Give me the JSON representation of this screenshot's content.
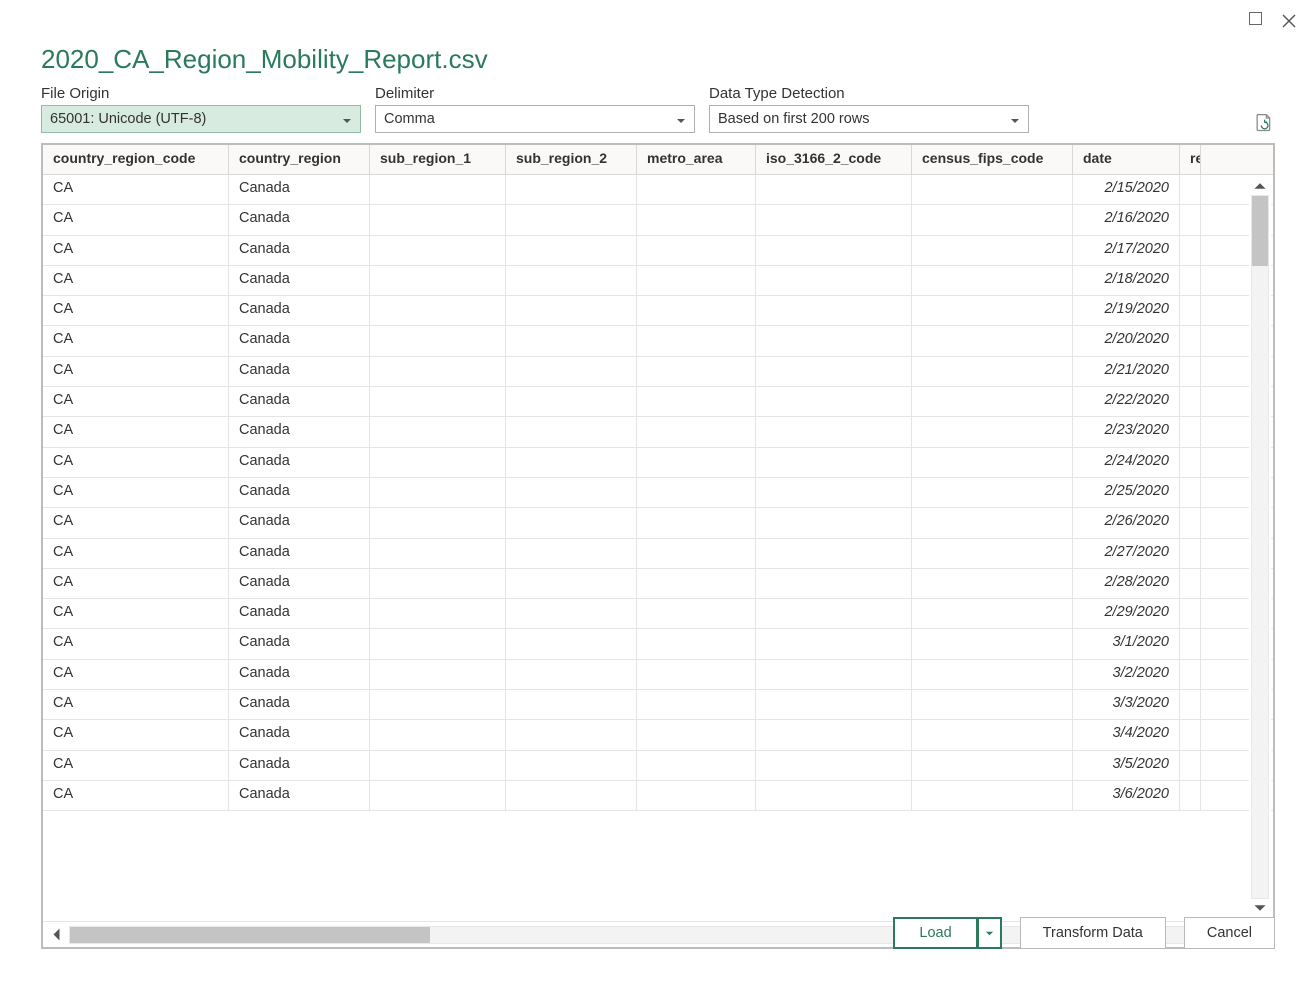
{
  "title": "2020_CA_Region_Mobility_Report.csv",
  "options": {
    "file_origin": {
      "label": "File Origin",
      "value": "65001: Unicode (UTF-8)"
    },
    "delimiter": {
      "label": "Delimiter",
      "value": "Comma"
    },
    "detection": {
      "label": "Data Type Detection",
      "value": "Based on first 200 rows"
    }
  },
  "columns": [
    "country_region_code",
    "country_region",
    "sub_region_1",
    "sub_region_2",
    "metro_area",
    "iso_3166_2_code",
    "census_fips_code",
    "date",
    "re"
  ],
  "rows": [
    {
      "code": "CA",
      "region": "Canada",
      "date": "2/15/2020"
    },
    {
      "code": "CA",
      "region": "Canada",
      "date": "2/16/2020"
    },
    {
      "code": "CA",
      "region": "Canada",
      "date": "2/17/2020"
    },
    {
      "code": "CA",
      "region": "Canada",
      "date": "2/18/2020"
    },
    {
      "code": "CA",
      "region": "Canada",
      "date": "2/19/2020"
    },
    {
      "code": "CA",
      "region": "Canada",
      "date": "2/20/2020"
    },
    {
      "code": "CA",
      "region": "Canada",
      "date": "2/21/2020"
    },
    {
      "code": "CA",
      "region": "Canada",
      "date": "2/22/2020"
    },
    {
      "code": "CA",
      "region": "Canada",
      "date": "2/23/2020"
    },
    {
      "code": "CA",
      "region": "Canada",
      "date": "2/24/2020"
    },
    {
      "code": "CA",
      "region": "Canada",
      "date": "2/25/2020"
    },
    {
      "code": "CA",
      "region": "Canada",
      "date": "2/26/2020"
    },
    {
      "code": "CA",
      "region": "Canada",
      "date": "2/27/2020"
    },
    {
      "code": "CA",
      "region": "Canada",
      "date": "2/28/2020"
    },
    {
      "code": "CA",
      "region": "Canada",
      "date": "2/29/2020"
    },
    {
      "code": "CA",
      "region": "Canada",
      "date": "3/1/2020"
    },
    {
      "code": "CA",
      "region": "Canada",
      "date": "3/2/2020"
    },
    {
      "code": "CA",
      "region": "Canada",
      "date": "3/3/2020"
    },
    {
      "code": "CA",
      "region": "Canada",
      "date": "3/4/2020"
    },
    {
      "code": "CA",
      "region": "Canada",
      "date": "3/5/2020"
    },
    {
      "code": "CA",
      "region": "Canada",
      "date": "3/6/2020"
    }
  ],
  "buttons": {
    "load": "Load",
    "transform": "Transform Data",
    "cancel": "Cancel"
  }
}
